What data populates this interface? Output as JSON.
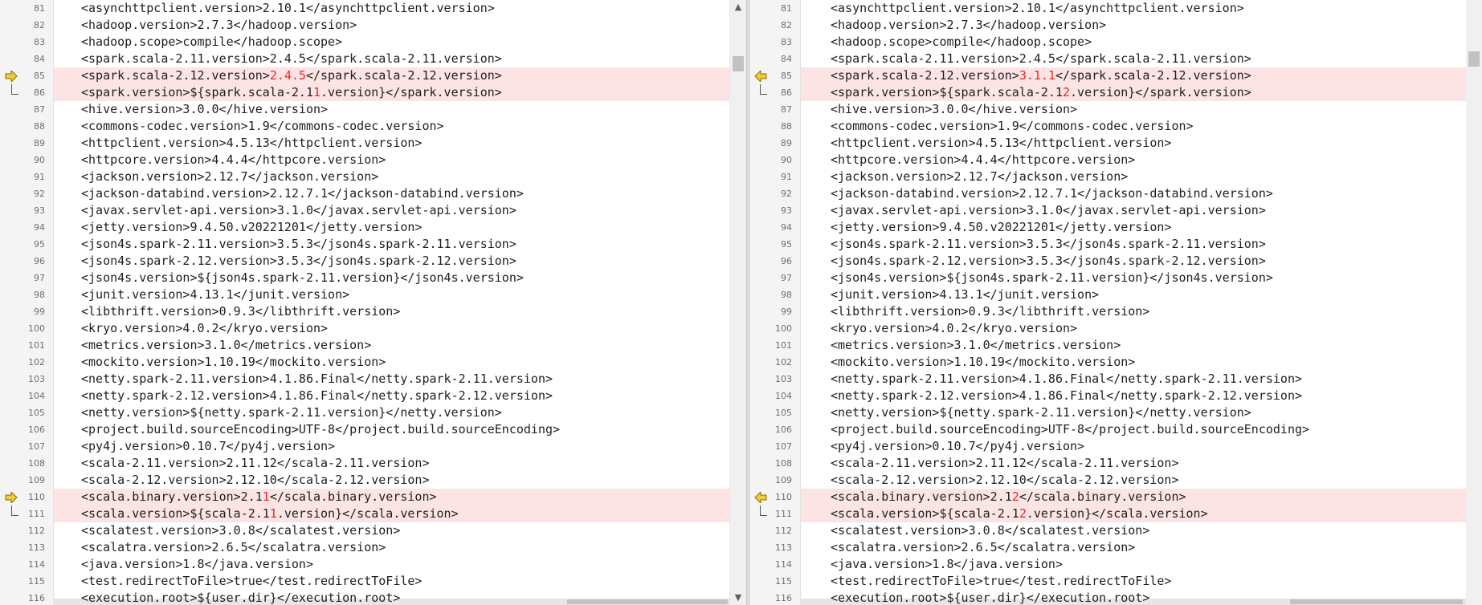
{
  "left_pane": {
    "lines": [
      {
        "num": "81",
        "segments": [
          {
            "t": "<asynchttpclient.version>2.10.1</asynchttpclient.version>"
          }
        ]
      },
      {
        "num": "82",
        "segments": [
          {
            "t": "<hadoop.version>2.7.3</hadoop.version>"
          }
        ]
      },
      {
        "num": "83",
        "segments": [
          {
            "t": "<hadoop.scope>compile</hadoop.scope>"
          }
        ]
      },
      {
        "num": "84",
        "segments": [
          {
            "t": "<spark.scala-2.11.version>2.4.5</spark.scala-2.11.version>"
          }
        ]
      },
      {
        "num": "85",
        "diff": true,
        "marker": "arrow-right-icon",
        "segments": [
          {
            "t": "<spark.scala-2.12.version>"
          },
          {
            "t": "2.4.5",
            "hl": true
          },
          {
            "t": "</spark.scala-2.12.version>"
          }
        ]
      },
      {
        "num": "86",
        "diff": true,
        "bracket": true,
        "segments": [
          {
            "t": "<spark.version>${spark.scala-2.1"
          },
          {
            "t": "1",
            "hl": true
          },
          {
            "t": ".version}</spark.version>"
          }
        ]
      },
      {
        "num": "87",
        "segments": [
          {
            "t": "<hive.version>3.0.0</hive.version>"
          }
        ]
      },
      {
        "num": "88",
        "segments": [
          {
            "t": "<commons-codec.version>1.9</commons-codec.version>"
          }
        ]
      },
      {
        "num": "89",
        "segments": [
          {
            "t": "<httpclient.version>4.5.13</httpclient.version>"
          }
        ]
      },
      {
        "num": "90",
        "segments": [
          {
            "t": "<httpcore.version>4.4.4</httpcore.version>"
          }
        ]
      },
      {
        "num": "91",
        "segments": [
          {
            "t": "<jackson.version>2.12.7</jackson.version>"
          }
        ]
      },
      {
        "num": "92",
        "segments": [
          {
            "t": "<jackson-databind.version>2.12.7.1</jackson-databind.version>"
          }
        ]
      },
      {
        "num": "93",
        "segments": [
          {
            "t": "<javax.servlet-api.version>3.1.0</javax.servlet-api.version>"
          }
        ]
      },
      {
        "num": "94",
        "segments": [
          {
            "t": "<jetty.version>9.4.50.v20221201</jetty.version>"
          }
        ]
      },
      {
        "num": "95",
        "segments": [
          {
            "t": "<json4s.spark-2.11.version>3.5.3</json4s.spark-2.11.version>"
          }
        ]
      },
      {
        "num": "96",
        "segments": [
          {
            "t": "<json4s.spark-2.12.version>3.5.3</json4s.spark-2.12.version>"
          }
        ]
      },
      {
        "num": "97",
        "segments": [
          {
            "t": "<json4s.version>${json4s.spark-2.11.version}</json4s.version>"
          }
        ]
      },
      {
        "num": "98",
        "segments": [
          {
            "t": "<junit.version>4.13.1</junit.version>"
          }
        ]
      },
      {
        "num": "99",
        "segments": [
          {
            "t": "<libthrift.version>0.9.3</libthrift.version>"
          }
        ]
      },
      {
        "num": "100",
        "segments": [
          {
            "t": "<kryo.version>4.0.2</kryo.version>"
          }
        ]
      },
      {
        "num": "101",
        "segments": [
          {
            "t": "<metrics.version>3.1.0</metrics.version>"
          }
        ]
      },
      {
        "num": "102",
        "segments": [
          {
            "t": "<mockito.version>1.10.19</mockito.version>"
          }
        ]
      },
      {
        "num": "103",
        "segments": [
          {
            "t": "<netty.spark-2.11.version>4.1.86.Final</netty.spark-2.11.version>"
          }
        ]
      },
      {
        "num": "104",
        "segments": [
          {
            "t": "<netty.spark-2.12.version>4.1.86.Final</netty.spark-2.12.version>"
          }
        ]
      },
      {
        "num": "105",
        "segments": [
          {
            "t": "<netty.version>${netty.spark-2.11.version}</netty.version>"
          }
        ]
      },
      {
        "num": "106",
        "segments": [
          {
            "t": "<project.build.sourceEncoding>UTF-8</project.build.sourceEncoding>"
          }
        ]
      },
      {
        "num": "107",
        "segments": [
          {
            "t": "<py4j.version>0.10.7</py4j.version>"
          }
        ]
      },
      {
        "num": "108",
        "segments": [
          {
            "t": "<scala-2.11.version>2.11.12</scala-2.11.version>"
          }
        ]
      },
      {
        "num": "109",
        "segments": [
          {
            "t": "<scala-2.12.version>2.12.10</scala-2.12.version>"
          }
        ]
      },
      {
        "num": "110",
        "diff": true,
        "marker": "arrow-right-icon",
        "segments": [
          {
            "t": "<scala.binary.version>2.1"
          },
          {
            "t": "1",
            "hl": true
          },
          {
            "t": "</scala.binary.version>"
          }
        ]
      },
      {
        "num": "111",
        "diff": true,
        "bracket": true,
        "segments": [
          {
            "t": "<scala.version>${scala-2.1"
          },
          {
            "t": "1",
            "hl": true
          },
          {
            "t": ".version}</scala.version>"
          }
        ]
      },
      {
        "num": "112",
        "segments": [
          {
            "t": "<scalatest.version>3.0.8</scalatest.version>"
          }
        ]
      },
      {
        "num": "113",
        "segments": [
          {
            "t": "<scalatra.version>2.6.5</scalatra.version>"
          }
        ]
      },
      {
        "num": "114",
        "segments": [
          {
            "t": "<java.version>1.8</java.version>"
          }
        ]
      },
      {
        "num": "115",
        "segments": [
          {
            "t": "<test.redirectToFile>true</test.redirectToFile>"
          }
        ]
      },
      {
        "num": "116",
        "segments": [
          {
            "t": "<execution.root>${user.dir}</execution.root>"
          }
        ]
      }
    ]
  },
  "right_pane": {
    "lines": [
      {
        "num": "81",
        "segments": [
          {
            "t": "<asynchttpclient.version>2.10.1</asynchttpclient.version>"
          }
        ]
      },
      {
        "num": "82",
        "segments": [
          {
            "t": "<hadoop.version>2.7.3</hadoop.version>"
          }
        ]
      },
      {
        "num": "83",
        "segments": [
          {
            "t": "<hadoop.scope>compile</hadoop.scope>"
          }
        ]
      },
      {
        "num": "84",
        "segments": [
          {
            "t": "<spark.scala-2.11.version>2.4.5</spark.scala-2.11.version>"
          }
        ]
      },
      {
        "num": "85",
        "diff": true,
        "marker": "arrow-left-icon",
        "segments": [
          {
            "t": "<spark.scala-2.12.version>"
          },
          {
            "t": "3.1.1",
            "hl": true
          },
          {
            "t": "</spark.scala-2.12.version>"
          }
        ]
      },
      {
        "num": "86",
        "diff": true,
        "bracket": true,
        "segments": [
          {
            "t": "<spark.version>${spark.scala-2.1"
          },
          {
            "t": "2",
            "hl": true
          },
          {
            "t": ".version}</spark.version>"
          }
        ]
      },
      {
        "num": "87",
        "segments": [
          {
            "t": "<hive.version>3.0.0</hive.version>"
          }
        ]
      },
      {
        "num": "88",
        "segments": [
          {
            "t": "<commons-codec.version>1.9</commons-codec.version>"
          }
        ]
      },
      {
        "num": "89",
        "segments": [
          {
            "t": "<httpclient.version>4.5.13</httpclient.version>"
          }
        ]
      },
      {
        "num": "90",
        "segments": [
          {
            "t": "<httpcore.version>4.4.4</httpcore.version>"
          }
        ]
      },
      {
        "num": "91",
        "segments": [
          {
            "t": "<jackson.version>2.12.7</jackson.version>"
          }
        ]
      },
      {
        "num": "92",
        "segments": [
          {
            "t": "<jackson-databind.version>2.12.7.1</jackson-databind.version>"
          }
        ]
      },
      {
        "num": "93",
        "segments": [
          {
            "t": "<javax.servlet-api.version>3.1.0</javax.servlet-api.version>"
          }
        ]
      },
      {
        "num": "94",
        "segments": [
          {
            "t": "<jetty.version>9.4.50.v20221201</jetty.version>"
          }
        ]
      },
      {
        "num": "95",
        "segments": [
          {
            "t": "<json4s.spark-2.11.version>3.5.3</json4s.spark-2.11.version>"
          }
        ]
      },
      {
        "num": "96",
        "segments": [
          {
            "t": "<json4s.spark-2.12.version>3.5.3</json4s.spark-2.12.version>"
          }
        ]
      },
      {
        "num": "97",
        "segments": [
          {
            "t": "<json4s.version>${json4s.spark-2.11.version}</json4s.version>"
          }
        ]
      },
      {
        "num": "98",
        "segments": [
          {
            "t": "<junit.version>4.13.1</junit.version>"
          }
        ]
      },
      {
        "num": "99",
        "segments": [
          {
            "t": "<libthrift.version>0.9.3</libthrift.version>"
          }
        ]
      },
      {
        "num": "100",
        "segments": [
          {
            "t": "<kryo.version>4.0.2</kryo.version>"
          }
        ]
      },
      {
        "num": "101",
        "segments": [
          {
            "t": "<metrics.version>3.1.0</metrics.version>"
          }
        ]
      },
      {
        "num": "102",
        "segments": [
          {
            "t": "<mockito.version>1.10.19</mockito.version>"
          }
        ]
      },
      {
        "num": "103",
        "segments": [
          {
            "t": "<netty.spark-2.11.version>4.1.86.Final</netty.spark-2.11.version>"
          }
        ]
      },
      {
        "num": "104",
        "segments": [
          {
            "t": "<netty.spark-2.12.version>4.1.86.Final</netty.spark-2.12.version>"
          }
        ]
      },
      {
        "num": "105",
        "segments": [
          {
            "t": "<netty.version>${netty.spark-2.11.version}</netty.version>"
          }
        ]
      },
      {
        "num": "106",
        "segments": [
          {
            "t": "<project.build.sourceEncoding>UTF-8</project.build.sourceEncoding>"
          }
        ]
      },
      {
        "num": "107",
        "segments": [
          {
            "t": "<py4j.version>0.10.7</py4j.version>"
          }
        ]
      },
      {
        "num": "108",
        "segments": [
          {
            "t": "<scala-2.11.version>2.11.12</scala-2.11.version>"
          }
        ]
      },
      {
        "num": "109",
        "segments": [
          {
            "t": "<scala-2.12.version>2.12.10</scala-2.12.version>"
          }
        ]
      },
      {
        "num": "110",
        "diff": true,
        "marker": "arrow-left-icon",
        "segments": [
          {
            "t": "<scala.binary.version>2.1"
          },
          {
            "t": "2",
            "hl": true
          },
          {
            "t": "</scala.binary.version>"
          }
        ]
      },
      {
        "num": "111",
        "diff": true,
        "bracket": true,
        "segments": [
          {
            "t": "<scala.version>${scala-2.1"
          },
          {
            "t": "2",
            "hl": true
          },
          {
            "t": ".version}</scala.version>"
          }
        ]
      },
      {
        "num": "112",
        "segments": [
          {
            "t": "<scalatest.version>3.0.8</scalatest.version>"
          }
        ]
      },
      {
        "num": "113",
        "segments": [
          {
            "t": "<scalatra.version>2.6.5</scalatra.version>"
          }
        ]
      },
      {
        "num": "114",
        "segments": [
          {
            "t": "<java.version>1.8</java.version>"
          }
        ]
      },
      {
        "num": "115",
        "segments": [
          {
            "t": "<test.redirectToFile>true</test.redirectToFile>"
          }
        ]
      },
      {
        "num": "116",
        "segments": [
          {
            "t": "<execution.root>${user.dir}</execution.root>"
          }
        ]
      }
    ]
  },
  "scrollbars": {
    "up_arrow_icon": "chevron-up-icon",
    "down_arrow_icon": "chevron-down-icon"
  },
  "colors": {
    "diff_background": "#fce4e4",
    "diff_highlight_text": "#e8262a",
    "marker_fill": "#f2cb3a",
    "gutter_background": "#f4f4f4"
  }
}
